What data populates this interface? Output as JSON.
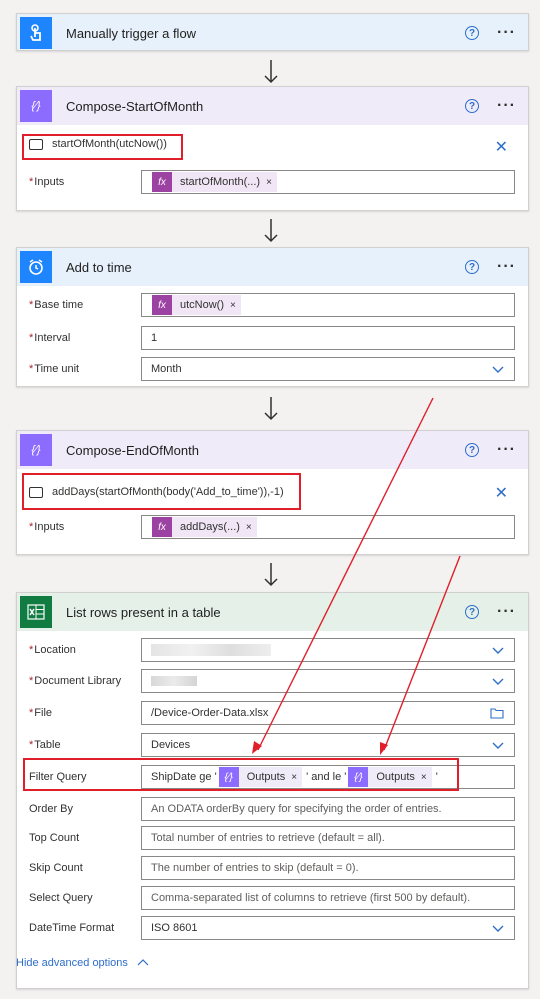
{
  "cards": {
    "trigger": {
      "title": "Manually trigger a flow",
      "color": "#1f85ff"
    },
    "compose_start": {
      "title": "Compose-StartOfMonth",
      "expression": "startOfMonth(utcNow())",
      "inputs_label": "Inputs",
      "token": "startOfMonth(...)"
    },
    "add_to_time": {
      "title": "Add to time",
      "base_time_label": "Base time",
      "base_time_token": "utcNow()",
      "interval_label": "Interval",
      "interval_value": "1",
      "time_unit_label": "Time unit",
      "time_unit_value": "Month"
    },
    "compose_end": {
      "title": "Compose-EndOfMonth",
      "expression": "addDays(startOfMonth(body('Add_to_time')),-1)",
      "inputs_label": "Inputs",
      "token": "addDays(...)"
    },
    "list_rows": {
      "title": "List rows present in a table",
      "location_label": "Location",
      "document_library_label": "Document Library",
      "file_label": "File",
      "file_value": "/Device-Order-Data.xlsx",
      "table_label": "Table",
      "table_value": "Devices",
      "filter_label": "Filter Query",
      "filter_prefix": "ShipDate ge '",
      "filter_token1": "Outputs",
      "filter_middle": "' and le '",
      "filter_token2": "Outputs",
      "filter_suffix": "'",
      "order_label": "Order By",
      "order_placeholder": "An ODATA orderBy query for specifying the order of entries.",
      "top_label": "Top Count",
      "top_placeholder": "Total number of entries to retrieve (default = all).",
      "skip_label": "Skip Count",
      "skip_placeholder": "The number of entries to skip (default = 0).",
      "select_label": "Select Query",
      "select_placeholder": "Comma-separated list of columns to retrieve (first 500 by default).",
      "datetime_label": "DateTime Format",
      "datetime_value": "ISO 8601",
      "hide_advanced": "Hide advanced options"
    }
  },
  "ui": {
    "help_glyph": "?",
    "more_glyph": "···",
    "required_mark": "*",
    "token_close": "×",
    "fx_glyph": "fx",
    "close_glyph": "✕"
  },
  "colors": {
    "trigger_bg": "#e6f1fb",
    "compose_bg": "#efebf9",
    "compose_icon": "#8c6cff",
    "time_bg": "#e6f1fb",
    "time_icon": "#1f85ff",
    "excel_bg": "#e5f1e8",
    "excel_icon": "#107c41",
    "highlight": "#e01f2b",
    "link": "#2e6ec9"
  }
}
